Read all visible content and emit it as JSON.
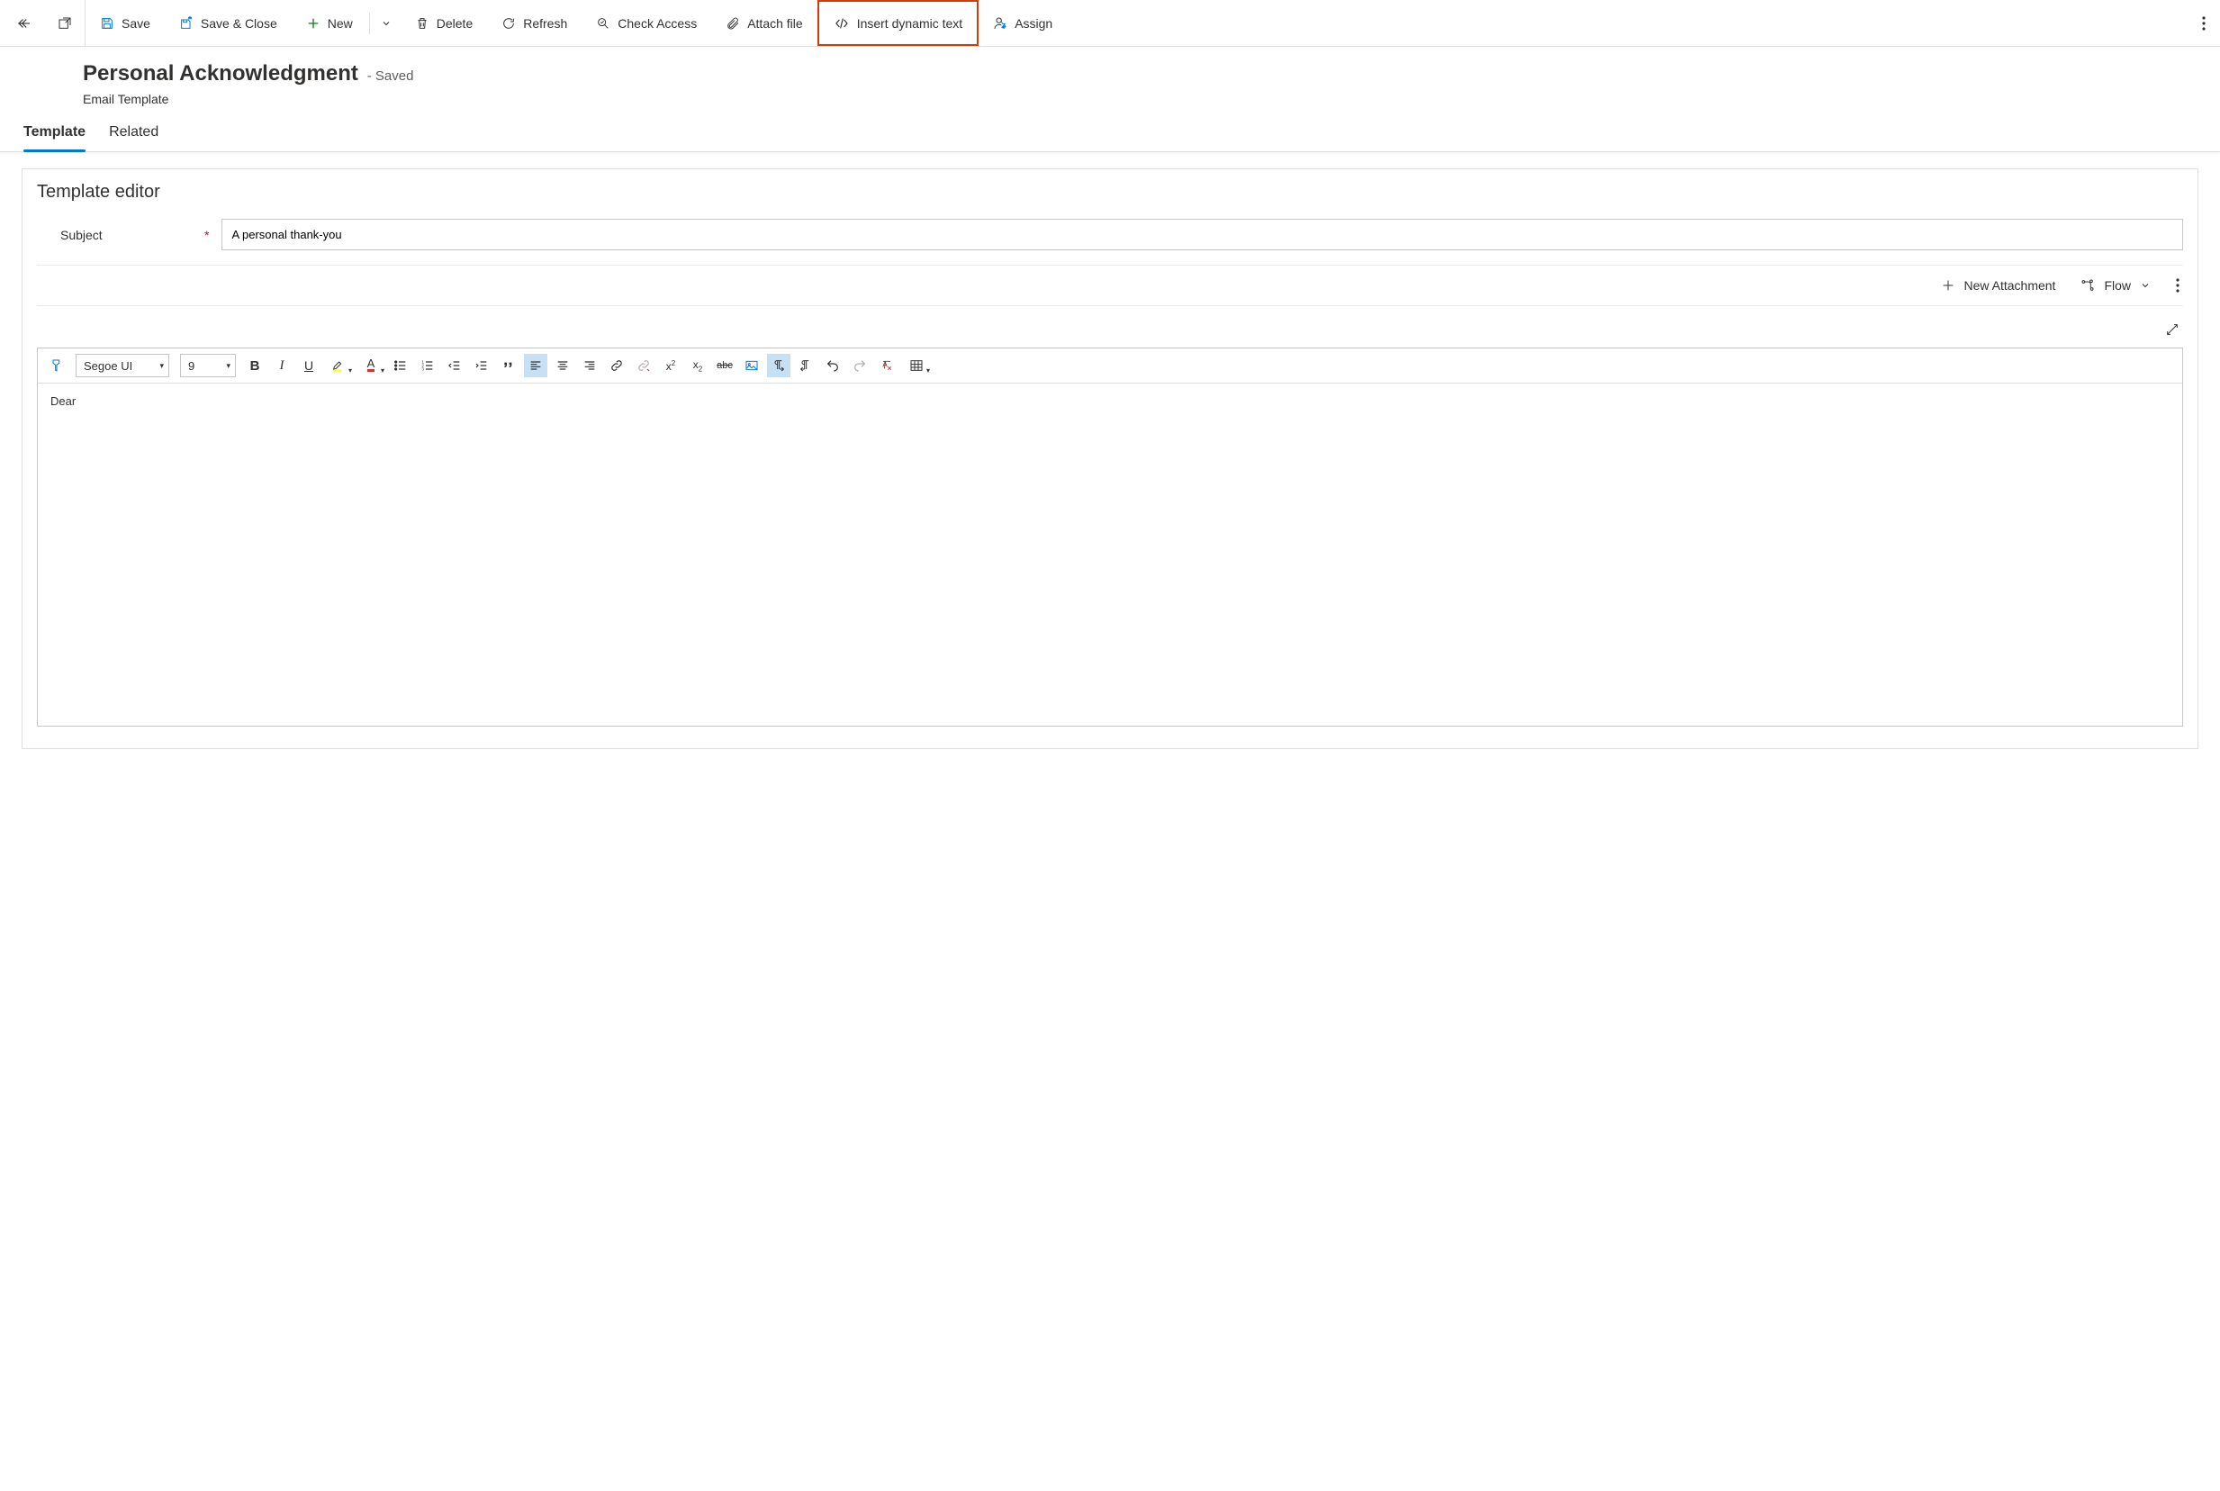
{
  "commandBar": {
    "save": "Save",
    "saveClose": "Save & Close",
    "new": "New",
    "delete": "Delete",
    "refresh": "Refresh",
    "checkAccess": "Check Access",
    "attachFile": "Attach file",
    "insertDynamicText": "Insert dynamic text",
    "assign": "Assign"
  },
  "header": {
    "title": "Personal Acknowledgment",
    "status": "- Saved",
    "subtitle": "Email Template"
  },
  "tabs": {
    "template": "Template",
    "related": "Related"
  },
  "panel": {
    "title": "Template editor",
    "subjectLabel": "Subject",
    "subjectValue": "A personal thank-you",
    "newAttachment": "New Attachment",
    "flow": "Flow"
  },
  "editor": {
    "font": "Segoe UI",
    "fontSize": "9",
    "body": "Dear"
  }
}
